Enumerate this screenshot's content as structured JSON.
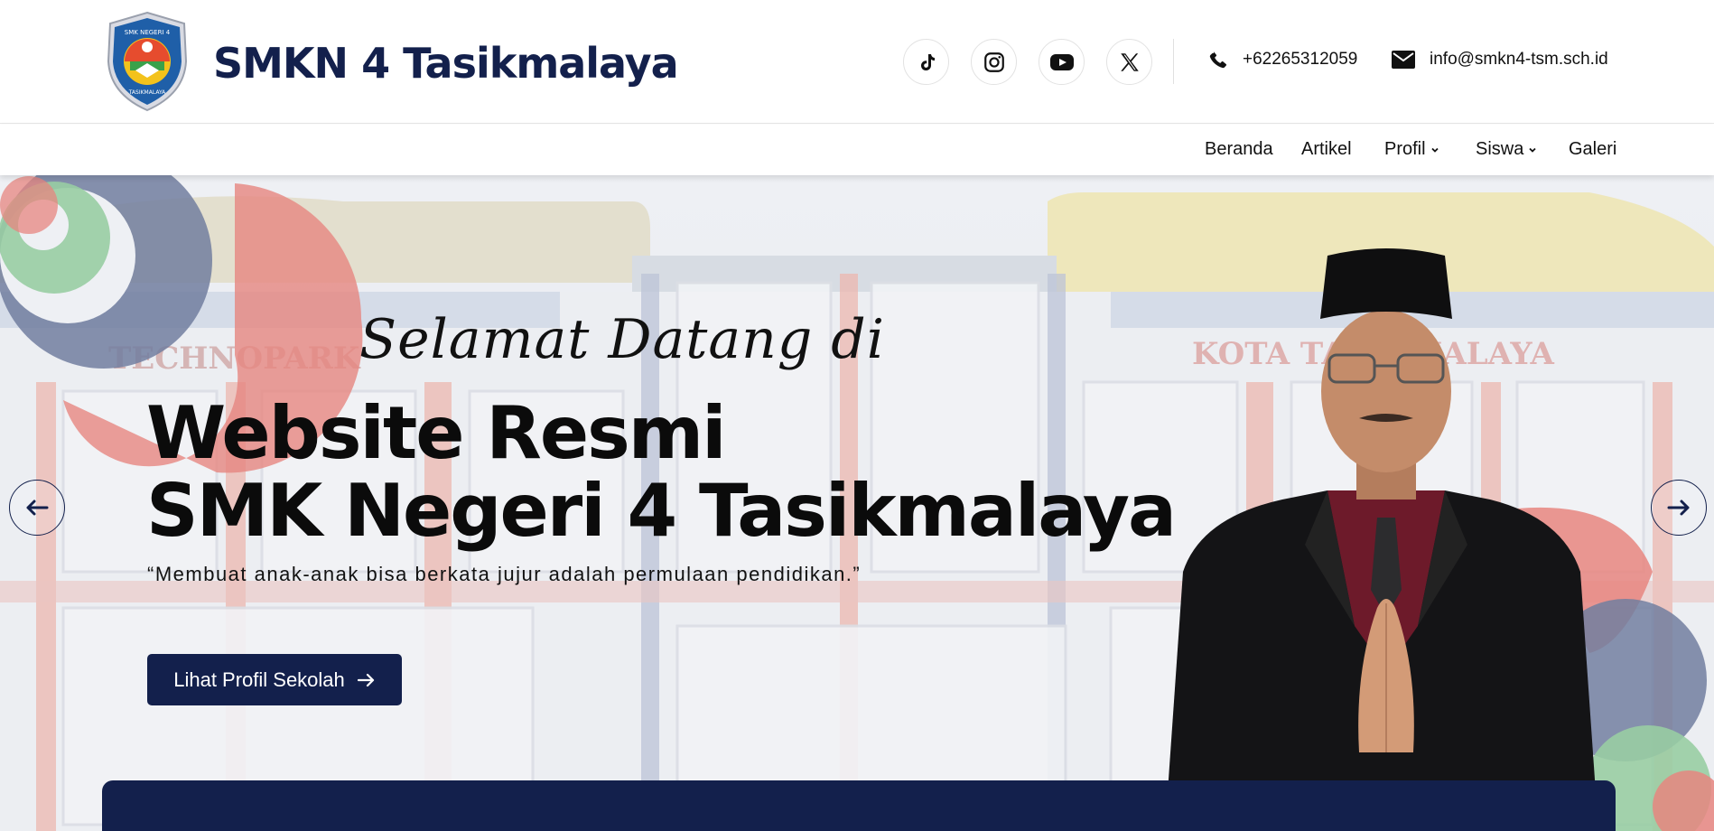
{
  "header": {
    "site_title": "SMKN 4 Tasikmalaya",
    "social": [
      {
        "name": "tiktok-icon"
      },
      {
        "name": "instagram-icon"
      },
      {
        "name": "youtube-icon"
      },
      {
        "name": "x-twitter-icon"
      }
    ],
    "phone": "+62265312059",
    "email": "info@smkn4-tsm.sch.id"
  },
  "nav": {
    "items": [
      {
        "label": "Beranda",
        "has_dropdown": false
      },
      {
        "label": "Artikel",
        "has_dropdown": false
      },
      {
        "label": "Profil",
        "has_dropdown": true
      },
      {
        "label": "Siswa",
        "has_dropdown": true
      },
      {
        "label": "Galeri",
        "has_dropdown": false
      }
    ]
  },
  "hero": {
    "welcome": "Selamat Datang di",
    "headline_line1": "Website Resmi",
    "headline_line2": "SMK Negeri 4 Tasikmalaya",
    "quote": "“Membuat anak-anak bisa berkata jujur adalah permulaan pendidikan.”",
    "cta_label": "Lihat Profil Sekolah",
    "building_sign_left": "TECHNOPARK",
    "building_sign_right": "KOTA TASIKMALAYA",
    "logo_text_top": "SMK NEGERI 4",
    "logo_text_bottom": "TASIKMALAYA"
  },
  "colors": {
    "brand_navy": "#13204c",
    "accent_red": "#e0645c",
    "accent_green": "#7cc08a",
    "accent_slate": "#4a5a85"
  }
}
